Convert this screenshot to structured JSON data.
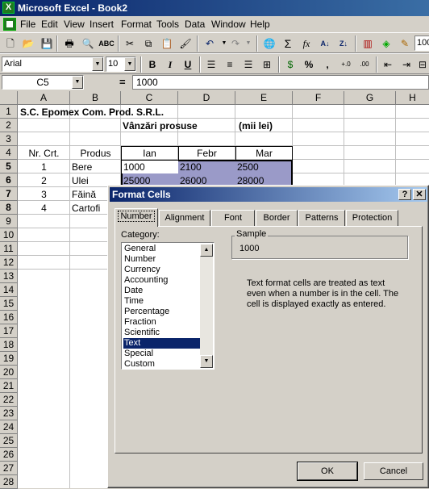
{
  "window": {
    "title": "Microsoft Excel - Book2"
  },
  "menu": [
    "File",
    "Edit",
    "View",
    "Insert",
    "Format",
    "Tools",
    "Data",
    "Window",
    "Help"
  ],
  "toolbar": {
    "font_name": "Arial",
    "font_size": "10",
    "zoom": "100"
  },
  "formula_bar": {
    "cell_ref": "C5",
    "equals": "=",
    "value": "1000"
  },
  "columns": [
    "A",
    "B",
    "C",
    "D",
    "E",
    "F",
    "G",
    "H"
  ],
  "rows": [
    "1",
    "2",
    "3",
    "4",
    "5",
    "6",
    "7",
    "8",
    "9",
    "10",
    "11",
    "12",
    "13",
    "14",
    "15",
    "16",
    "17",
    "18",
    "19",
    "20",
    "21",
    "22",
    "23",
    "24",
    "25",
    "26",
    "27",
    "28"
  ],
  "cells": {
    "A1": "S.C. Epomex Com. Prod. S.R.L.",
    "C2": "Vânzări prosuse",
    "E2": "(mii lei)",
    "A4": "Nr. Crt.",
    "B4": "Produs",
    "C4": "Ian",
    "D4": "Febr",
    "E4": "Mar",
    "A5": "1",
    "B5": "Bere",
    "C5": "1000",
    "D5": "2100",
    "E5": "2500",
    "A6": "2",
    "B6": "Ulei",
    "C6": "25000",
    "D6": "26000",
    "E6": "28000",
    "A7": "3",
    "B7": "Făină",
    "A8": "4",
    "B8": "Cartofi"
  },
  "dialog": {
    "title": "Format Cells",
    "help": "?",
    "close": "✕",
    "tabs": [
      "Number",
      "Alignment",
      "Font",
      "Border",
      "Patterns",
      "Protection"
    ],
    "category_label": "Category:",
    "categories": [
      "General",
      "Number",
      "Currency",
      "Accounting",
      "Date",
      "Time",
      "Percentage",
      "Fraction",
      "Scientific",
      "Text",
      "Special",
      "Custom"
    ],
    "selected_category": "Text",
    "sample_label": "Sample",
    "sample_value": "1000",
    "description": "Text format cells are treated as text even when a number is in the cell.  The cell is displayed exactly as entered.",
    "ok": "OK",
    "cancel": "Cancel"
  },
  "colors": {
    "title_bar": "#0a246a",
    "selection": "#9a9ac8",
    "list_highlight": "#0a246a"
  },
  "icons": [
    "excel-icon",
    "new-icon",
    "open-icon",
    "save-icon",
    "print-icon",
    "print-preview-icon",
    "spelling-icon",
    "cut-icon",
    "copy-icon",
    "paste-icon",
    "format-painter-icon",
    "undo-icon",
    "redo-icon",
    "hyperlink-icon",
    "autosum-icon",
    "function-icon",
    "sort-ascending-icon",
    "sort-descending-icon",
    "chart-wizard-icon",
    "drawing-icon"
  ]
}
